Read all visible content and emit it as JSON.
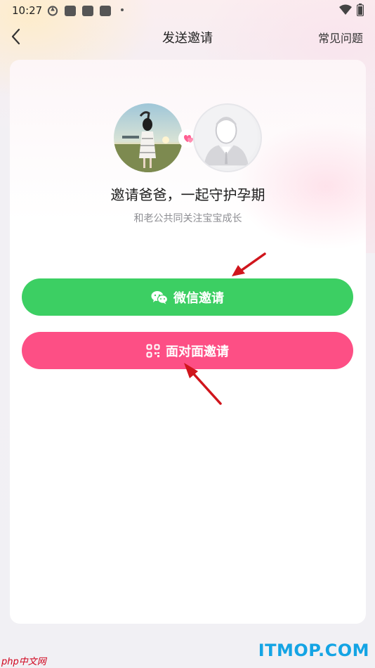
{
  "status_bar": {
    "time": "10:27"
  },
  "header": {
    "title": "发送邀请",
    "help_link": "常见问题"
  },
  "invite": {
    "headline": "邀请爸爸，一起守护孕期",
    "subtitle": "和老公共同关注宝宝成长"
  },
  "buttons": {
    "wechat_label": "微信邀请",
    "face_to_face_label": "面对面邀请"
  },
  "watermarks": {
    "left": "php中文网",
    "right": "ITMOP.COM"
  },
  "colors": {
    "wechat_green": "#3ccf63",
    "invite_pink": "#fd4f85",
    "arrow_red": "#d0151c",
    "watermark_blue": "#14a4e4"
  }
}
